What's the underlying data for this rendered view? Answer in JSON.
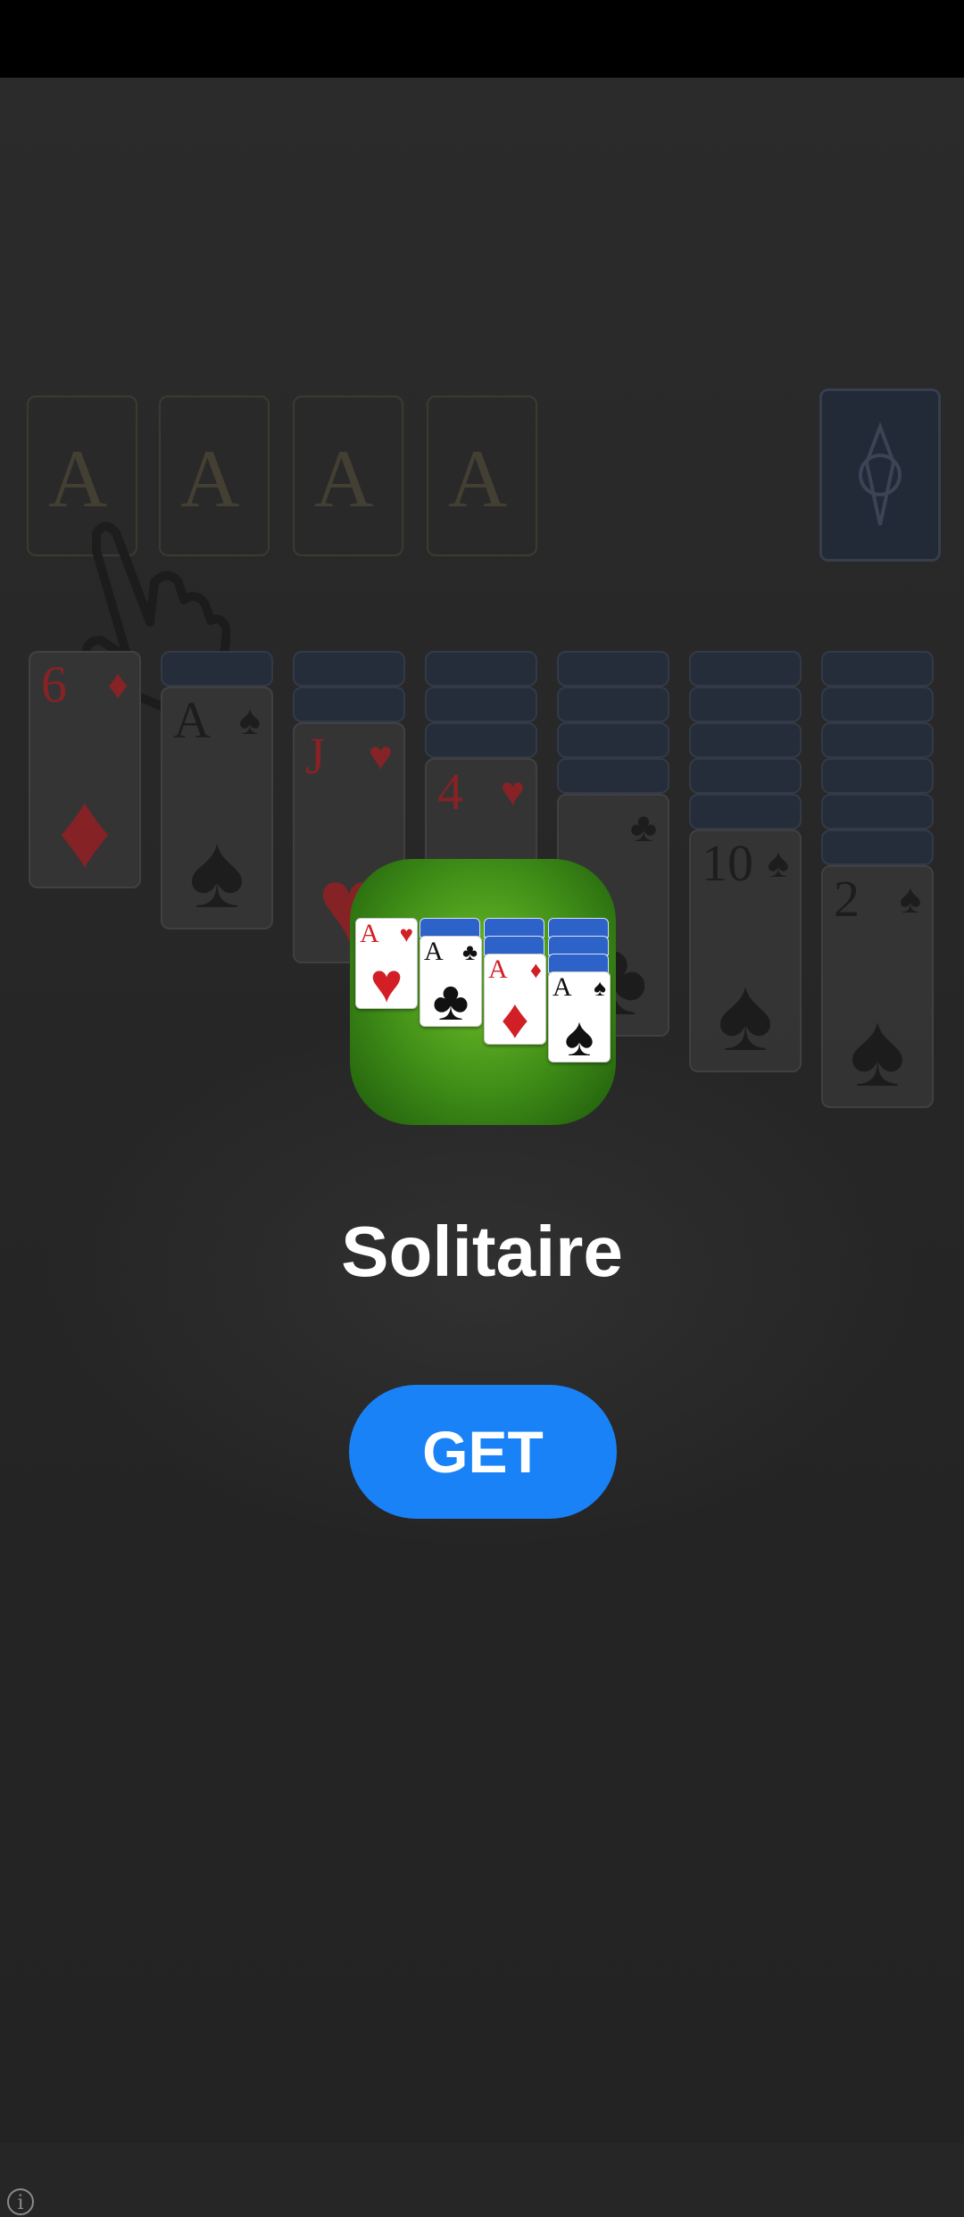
{
  "app": {
    "name": "Solitaire",
    "cta_label": "GET",
    "info_symbol": "i"
  },
  "colors": {
    "button": "#1a82f7",
    "icon_green": "#3f8d17",
    "overlay_bg": "#262626"
  },
  "background_game": {
    "foundation_label": "A",
    "tableau": [
      {
        "rank": "6",
        "suit": "♦",
        "red": true
      },
      {
        "rank": "A",
        "suit": "♠",
        "red": false
      },
      {
        "rank": "J",
        "suit": "♥",
        "red": true
      },
      {
        "rank": "4",
        "suit": "♥",
        "red": true
      },
      {
        "rank": "",
        "suit": "♣",
        "red": false
      },
      {
        "rank": "10",
        "suit": "♠",
        "red": false
      },
      {
        "rank": "2",
        "suit": "♠",
        "red": false
      }
    ]
  },
  "icon_cards": [
    {
      "rank": "A",
      "suit": "♥",
      "red": true
    },
    {
      "rank": "A",
      "suit": "♣",
      "red": false
    },
    {
      "rank": "A",
      "suit": "♦",
      "red": true
    },
    {
      "rank": "A",
      "suit": "♠",
      "red": false
    }
  ]
}
